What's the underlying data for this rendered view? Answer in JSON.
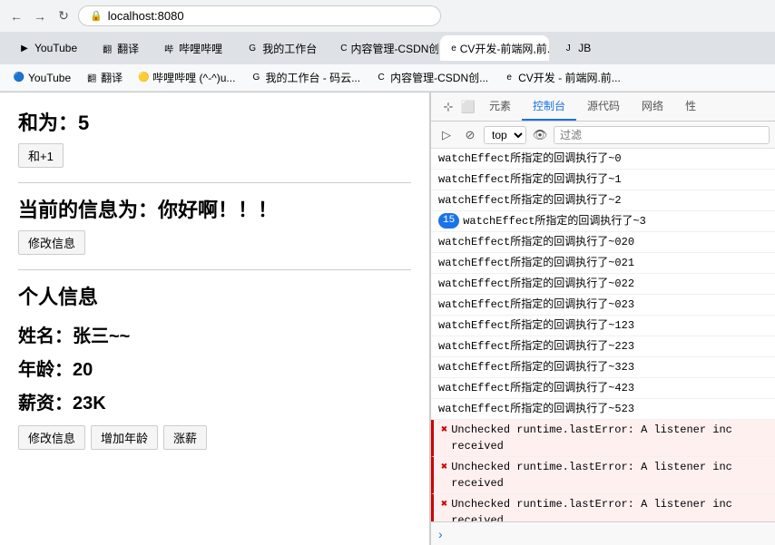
{
  "browser": {
    "address": "localhost:8080",
    "nav": {
      "back": "←",
      "forward": "→",
      "refresh": "↻"
    },
    "tabs": [
      {
        "id": "tab1",
        "favicon": "▶",
        "label": "YouTube",
        "active": false
      },
      {
        "id": "tab2",
        "favicon": "翻",
        "label": "翻译",
        "active": false
      },
      {
        "id": "tab3",
        "favicon": "哔",
        "label": "哔哩哔哩",
        "active": false
      },
      {
        "id": "tab4",
        "favicon": "G",
        "label": "我的工作台",
        "active": false
      },
      {
        "id": "tab5",
        "favicon": "C",
        "label": "内容管理-CSDN创...",
        "active": false
      },
      {
        "id": "tab6",
        "favicon": "e",
        "label": "CV开发-前端网,前...",
        "active": true
      },
      {
        "id": "tab7",
        "favicon": "J",
        "label": "JB",
        "active": false
      }
    ],
    "bookmarks": [
      {
        "favicon": "🔵",
        "label": "YouTube"
      },
      {
        "favicon": "翻",
        "label": "翻译"
      },
      {
        "favicon": "🟡",
        "label": "哔哩哔哩 (^-^)u..."
      },
      {
        "favicon": "G",
        "label": "我的工作台 - 码云..."
      },
      {
        "favicon": "C",
        "label": "内容管理-CSDN创..."
      },
      {
        "favicon": "e",
        "label": "CV开发 - 前端网.前..."
      }
    ]
  },
  "page": {
    "sum_label": "和为：5",
    "add_btn": "和+1",
    "msg_label": "当前的信息为：你好啊！！！",
    "modify_msg_btn": "修改信息",
    "person_title": "个人信息",
    "name_label": "姓名：张三~~",
    "age_label": "年龄：20",
    "salary_label": "薪资：23K",
    "modify_btn": "修改信息",
    "add_age_btn": "增加年龄",
    "salary_btn": "涨薪"
  },
  "devtools": {
    "tabs": [
      "元素",
      "控制台",
      "源代码",
      "网络",
      "性"
    ],
    "active_tab": "控制台",
    "toolbar": {
      "top_label": "top",
      "filter_placeholder": "过滤"
    },
    "console_rows": [
      {
        "type": "normal",
        "text": "watchEffect所指定的回调执行了~0",
        "badge": null
      },
      {
        "type": "normal",
        "text": "watchEffect所指定的回调执行了~1",
        "badge": null
      },
      {
        "type": "normal",
        "text": "watchEffect所指定的回调执行了~2",
        "badge": null
      },
      {
        "type": "badge",
        "text": "watchEffect所指定的回调执行了~3",
        "badge": "15"
      },
      {
        "type": "normal",
        "text": "watchEffect所指定的回调执行了~020",
        "badge": null
      },
      {
        "type": "normal",
        "text": "watchEffect所指定的回调执行了~021",
        "badge": null
      },
      {
        "type": "normal",
        "text": "watchEffect所指定的回调执行了~022",
        "badge": null
      },
      {
        "type": "normal",
        "text": "watchEffect所指定的回调执行了~023",
        "badge": null
      },
      {
        "type": "normal",
        "text": "watchEffect所指定的回调执行了~123",
        "badge": null
      },
      {
        "type": "normal",
        "text": "watchEffect所指定的回调执行了~223",
        "badge": null
      },
      {
        "type": "normal",
        "text": "watchEffect所指定的回调执行了~323",
        "badge": null
      },
      {
        "type": "normal",
        "text": "watchEffect所指定的回调执行了~423",
        "badge": null
      },
      {
        "type": "normal",
        "text": "watchEffect所指定的回调执行了~523",
        "badge": null
      },
      {
        "type": "error",
        "text": "Unchecked runtime.lastError: A listener inc\nreceived",
        "badge": null
      },
      {
        "type": "error",
        "text": "Unchecked runtime.lastError: A listener inc\nreceived",
        "badge": null
      },
      {
        "type": "error",
        "text": "Unchecked runtime.lastError: A listener inc\nreceived",
        "badge": null
      }
    ]
  }
}
